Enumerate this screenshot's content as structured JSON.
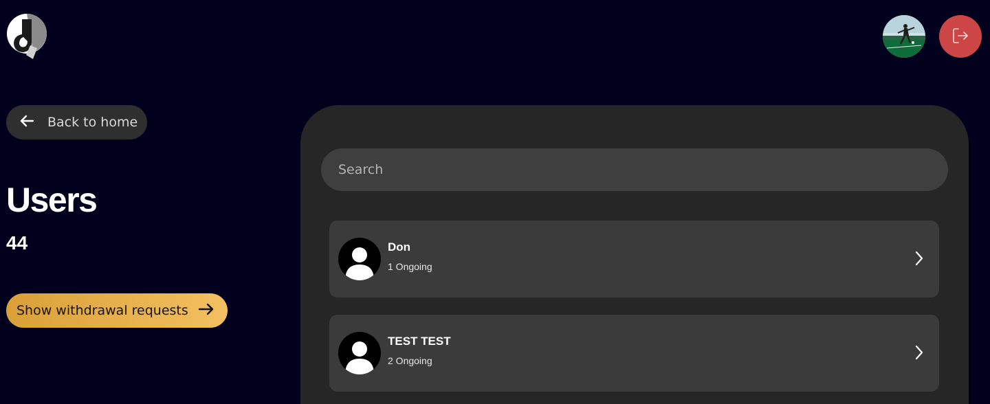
{
  "header": {
    "logo_icon": "app-logo-icon",
    "profile_icon": "profile-photo-avatar",
    "logout_icon": "logout-icon"
  },
  "sidebar": {
    "back_label": "Back to home",
    "title": "Users",
    "count": "44",
    "withdraw_label": "Show withdrawal requests"
  },
  "search": {
    "placeholder": "Search",
    "value": ""
  },
  "users": [
    {
      "name": "Don",
      "status": "1 Ongoing"
    },
    {
      "name": "TEST TEST",
      "status": "2 Ongoing"
    }
  ],
  "colors": {
    "background": "#02011d",
    "panel": "#262626",
    "card": "#3b3b3b",
    "logout": "#cc4646",
    "accent_start": "#d9a038",
    "accent_end": "#f3c061"
  }
}
